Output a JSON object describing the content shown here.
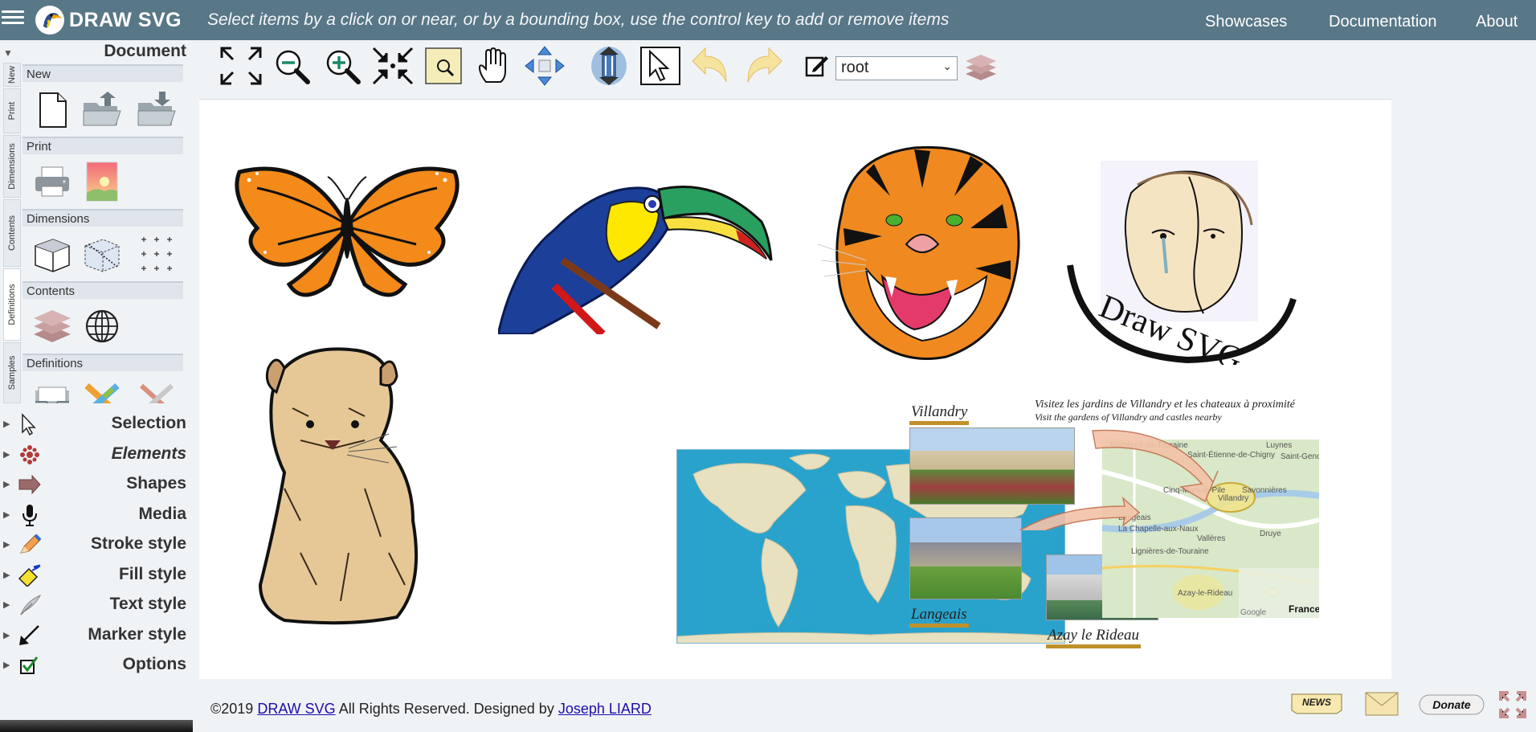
{
  "header": {
    "brand": "DRAW SVG",
    "tagline": "Select items by a click on or near, or by a bounding box, use the control key to add or remove items",
    "nav": [
      "Showcases",
      "Documentation",
      "About"
    ]
  },
  "sidebar": {
    "document_title": "Document",
    "vertical_tabs": [
      "New",
      "Print",
      "Dimensions",
      "Contents",
      "Definitions",
      "Samples"
    ],
    "panels": [
      {
        "label": "New",
        "icons": [
          "new-document-icon",
          "open-folder-icon",
          "save-folder-icon"
        ]
      },
      {
        "label": "Print",
        "icons": [
          "printer-icon",
          "export-image-icon"
        ]
      },
      {
        "label": "Dimensions",
        "icons": [
          "box-dimensions-icon",
          "box-selection-icon",
          "grid-icon"
        ]
      },
      {
        "label": "Contents",
        "icons": [
          "layers-icon",
          "globe-icon"
        ]
      },
      {
        "label": "Definitions",
        "icons": [
          "inbox-icon",
          "gradient-tools-icon",
          "pattern-tools-icon"
        ]
      }
    ],
    "categories": [
      {
        "label": "Selection",
        "icon": "cursor-icon"
      },
      {
        "label": "Elements",
        "icon": "elements-icon"
      },
      {
        "label": "Shapes",
        "icon": "arrow-shape-icon"
      },
      {
        "label": "Media",
        "icon": "microphone-icon"
      },
      {
        "label": "Stroke style",
        "icon": "pencil-icon"
      },
      {
        "label": "Fill style",
        "icon": "paint-bucket-icon"
      },
      {
        "label": "Text style",
        "icon": "quill-icon"
      },
      {
        "label": "Marker style",
        "icon": "marker-arrow-icon"
      },
      {
        "label": "Options",
        "icon": "checkbox-icon"
      }
    ]
  },
  "toolbar": {
    "tools": [
      "fit-view-icon",
      "zoom-out-icon",
      "zoom-in-icon",
      "zoom-fit-icon",
      "zoom-box-icon",
      "pan-hand-icon",
      "move-arrows-icon",
      "resize-icon",
      "select-arrow-icon",
      "undo-icon",
      "redo-icon",
      "edit-icon"
    ],
    "layer_value": "root",
    "layers_icon": "layers-icon"
  },
  "canvas": {
    "map_captions": {
      "line1": "Visitez les jardins de Villandry et les chateaux à proximité",
      "line2": "Visit the gardens of Villandry and castles nearby"
    },
    "places": [
      "Villandry",
      "Langeais",
      "Azay le Rideau"
    ],
    "logo_text": "Draw SVG",
    "map_labels": [
      "Luynes",
      "Saint-Étienne-de-Chigny",
      "Saint-Genou",
      "Cinq-Mars-la-Pile",
      "Savonnières",
      "Villandry",
      "Langeais",
      "La Chapelle-aux-Naux",
      "Vallères",
      "Druye",
      "Lignières-de-Touraine",
      "Azay-le-Rideau",
      "Google",
      "France",
      "Mazières-de-Touraine"
    ]
  },
  "footer": {
    "copyright": "©2019",
    "site_link": "DRAW SVG",
    "rights": "All Rights Reserved. Designed by",
    "author_link": "Joseph LIARD",
    "news_label": "NEWS",
    "donate_label": "Donate"
  },
  "colors": {
    "topbar": "#587787",
    "accent_gold": "#c0902a",
    "ocean": "#2aa3cc",
    "land": "#e8e1bf"
  }
}
